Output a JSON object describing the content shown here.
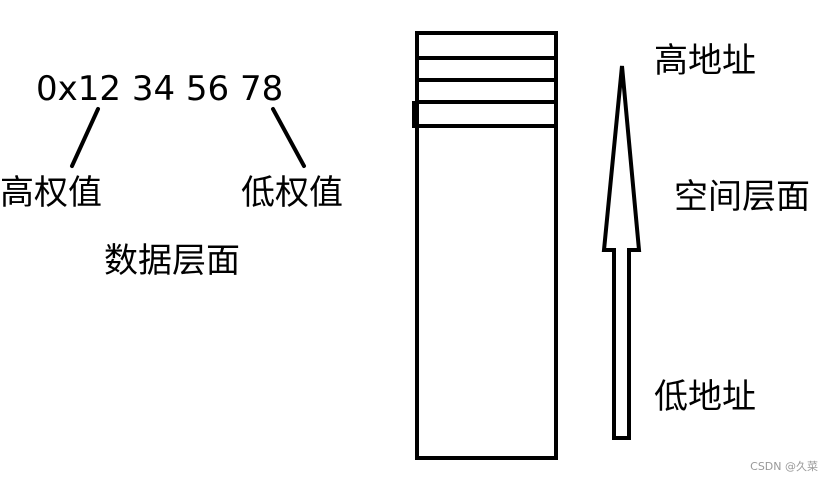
{
  "diagram": {
    "hex_value": "0x12 34 56 78",
    "high_weight_label": "高权值",
    "low_weight_label": "低权值",
    "data_level_label": "数据层面",
    "high_address_label": "高地址",
    "space_level_label": "空间层面",
    "low_address_label": "低地址",
    "watermark": "CSDN @久菜"
  }
}
